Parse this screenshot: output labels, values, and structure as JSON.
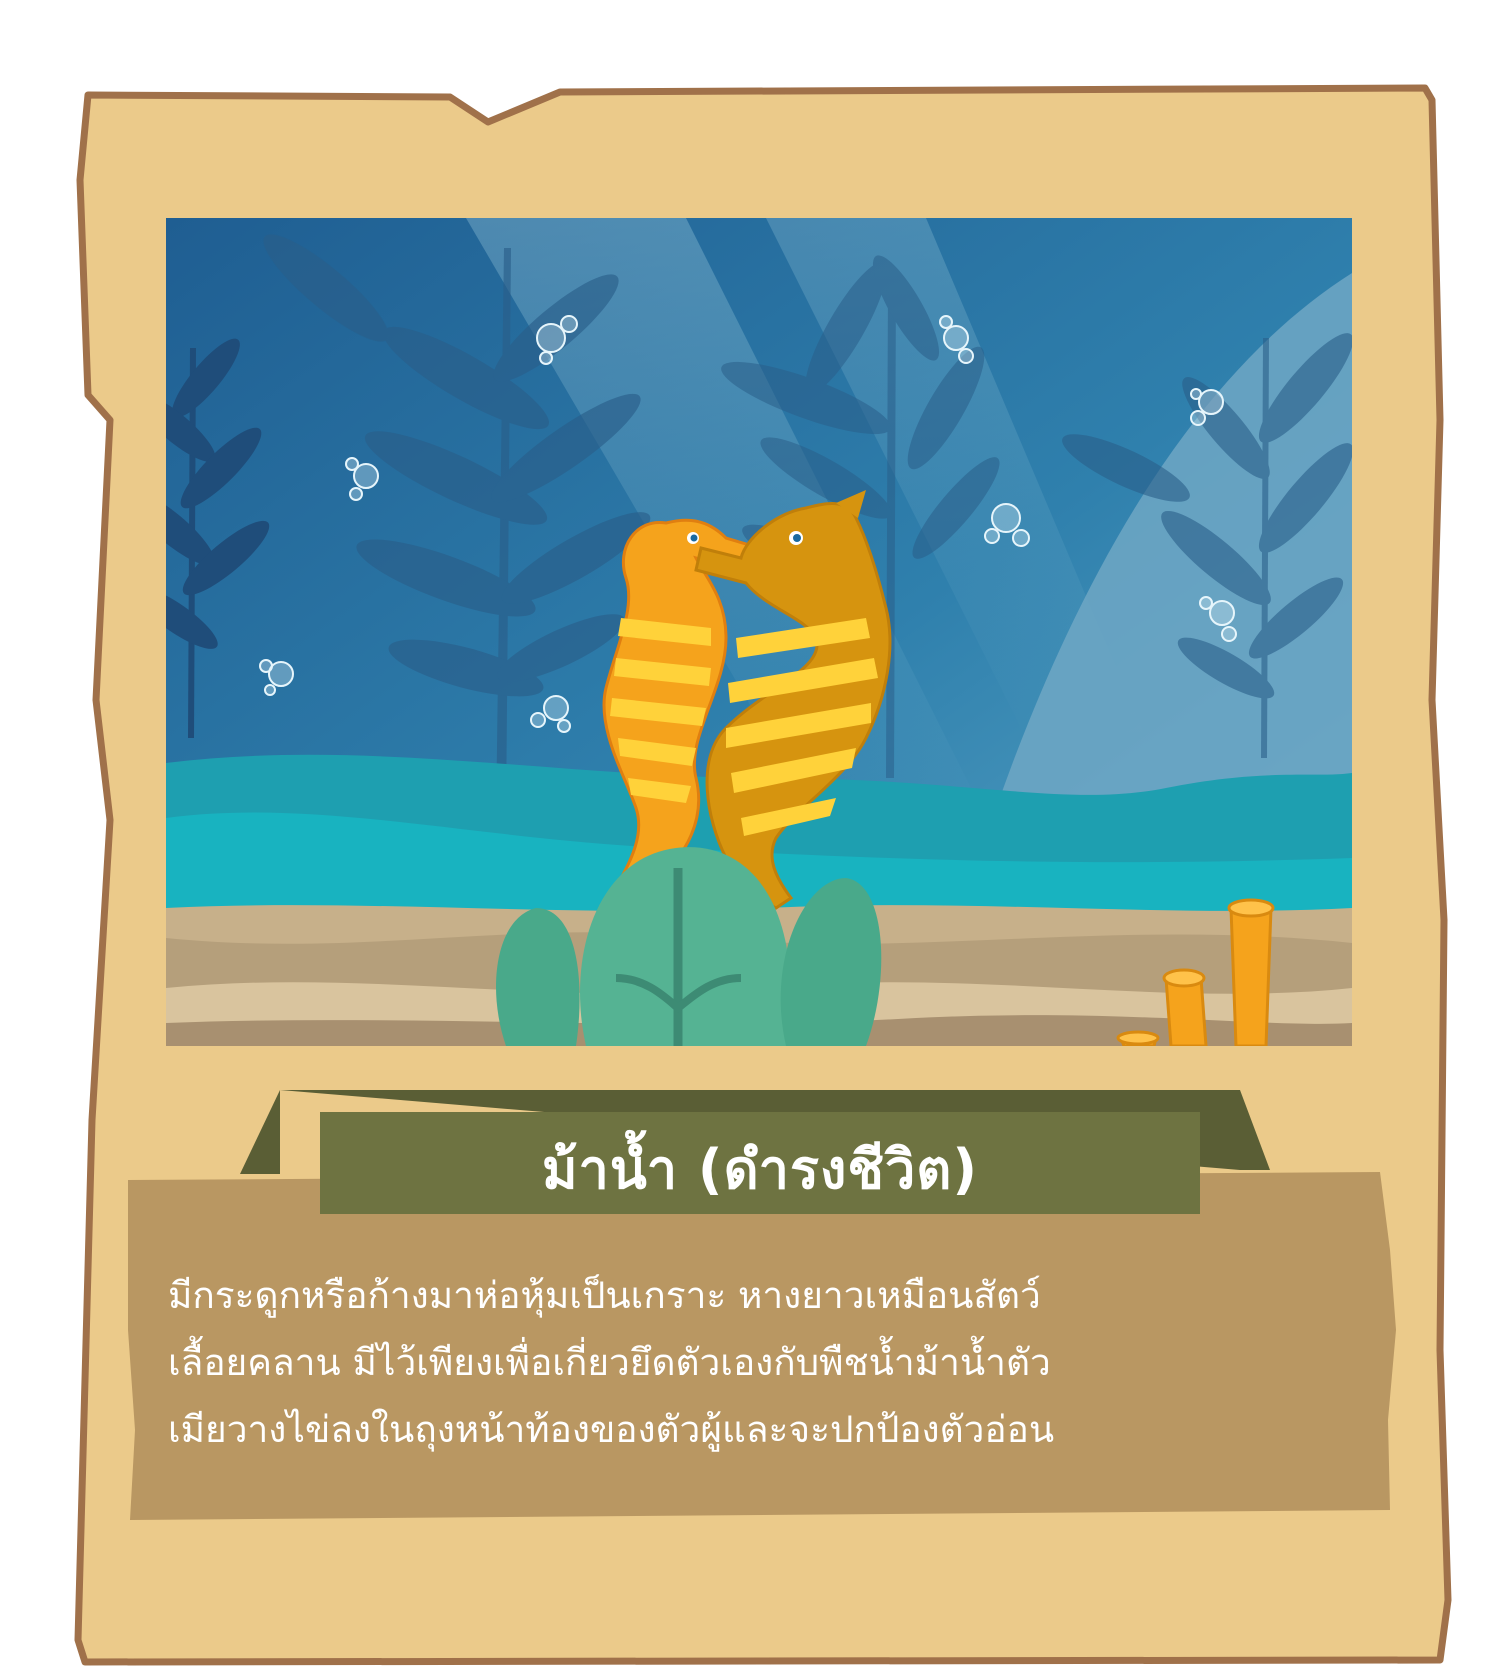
{
  "card": {
    "title": "ม้าน้ำ (ดำรงชีวิต)",
    "description_lines": [
      "มีกระดูกหรือก้างมาห่อหุ้มเป็นเกราะ หางยาวเหมือนสัตว์",
      "เลื้อยคลาน มีไว้เพียงเพื่อเกี่ยวยึดตัวเองกับพืชน้ำม้าน้ำตัว",
      "เมียวางไข่ลงในถุงหน้าท้องของตัวผู้และจะปกป้องตัวอ่อน"
    ]
  },
  "colors": {
    "parchment": "#ebca8a",
    "parchment_border": "#a0714a",
    "ribbon": "#6e7341",
    "ribbon_dark": "#5a5e35",
    "text_panel": "#b99762",
    "sea_deep": "#1f5e92",
    "sea_light": "#6bb3cf",
    "teal_floor": "#1aa9b8",
    "sand": "#cdb488",
    "seahorse_left": "#f5a31c",
    "seahorse_right": "#d6940f",
    "sea_plant": "#49a98a",
    "coral": "#f5a31c"
  },
  "icons": [
    "seahorse-icon",
    "seahorse-icon",
    "seaweed-icon",
    "bubble-icon",
    "sea-plant-icon",
    "tube-coral-icon"
  ]
}
